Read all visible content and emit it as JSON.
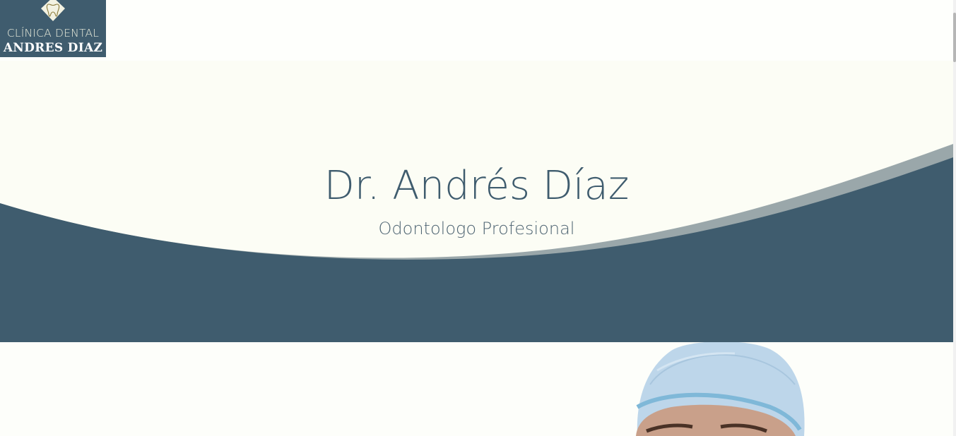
{
  "header": {
    "logo": {
      "line1": "CLÍNICA DENTAL",
      "line2": "ANDRES DIAZ",
      "icon": "tooth-icon"
    }
  },
  "hero": {
    "title": "Dr. Andrés Díaz",
    "subtitle": "Odontologo Profesional"
  },
  "colors": {
    "brand": "#3f5c6e",
    "wave_accent": "#9aa7aa",
    "background": "#fdfefa",
    "text_subtitle": "#4e6472"
  }
}
